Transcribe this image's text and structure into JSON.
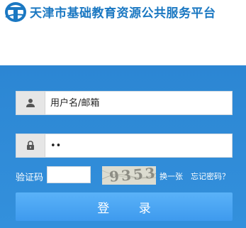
{
  "header": {
    "logo_icon": "tianjin-education-logo",
    "title": "天津市基础教育资源公共服务平台"
  },
  "login": {
    "username": {
      "icon": "user-icon",
      "placeholder": "用户名/邮箱",
      "value": ""
    },
    "password": {
      "icon": "lock-icon",
      "value": "••"
    },
    "captcha": {
      "label": "验证码",
      "value": "",
      "image_text": "9353",
      "refresh_label": "换一张",
      "forgot_label": "忘记密码？"
    },
    "submit_label": "登 录"
  },
  "colors": {
    "brand": "#1b78c2",
    "panel": "#2f8ad6",
    "button": "#4ea8f4"
  }
}
